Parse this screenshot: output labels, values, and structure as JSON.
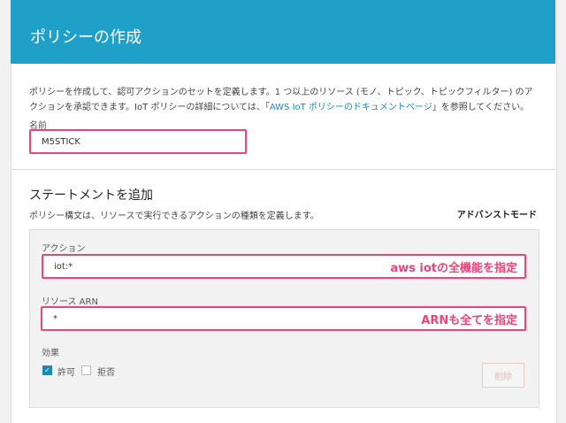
{
  "header": {
    "title": "ポリシーの作成"
  },
  "description": {
    "text_before": "ポリシーを作成して、認可アクションのセットを定義します。1 つ以上のリソース (モノ、トピック、トピックフィルター) のアクションを承認できます。IoT ポリシーの詳細については、「",
    "link": "AWS IoT ポリシーのドキュメントページ",
    "text_after": "」を参照してください。"
  },
  "name": {
    "label": "名前",
    "value": "M5STICK"
  },
  "statement": {
    "title": "ステートメントを追加",
    "subtitle": "ポリシー構文は、リソースで実行できるアクションの種類を定義します。",
    "advanced_mode": "アドバンストモード",
    "action": {
      "label": "アクション",
      "value": "iot:*",
      "annotation": "aws iotの全機能を指定"
    },
    "resource": {
      "label": "リソース ARN",
      "value": "*",
      "annotation": "ARNも全てを指定"
    },
    "effect": {
      "label": "効果",
      "allow": "許可",
      "deny": "拒否",
      "allow_checked": true,
      "deny_checked": false
    },
    "delete_label": "削除"
  }
}
